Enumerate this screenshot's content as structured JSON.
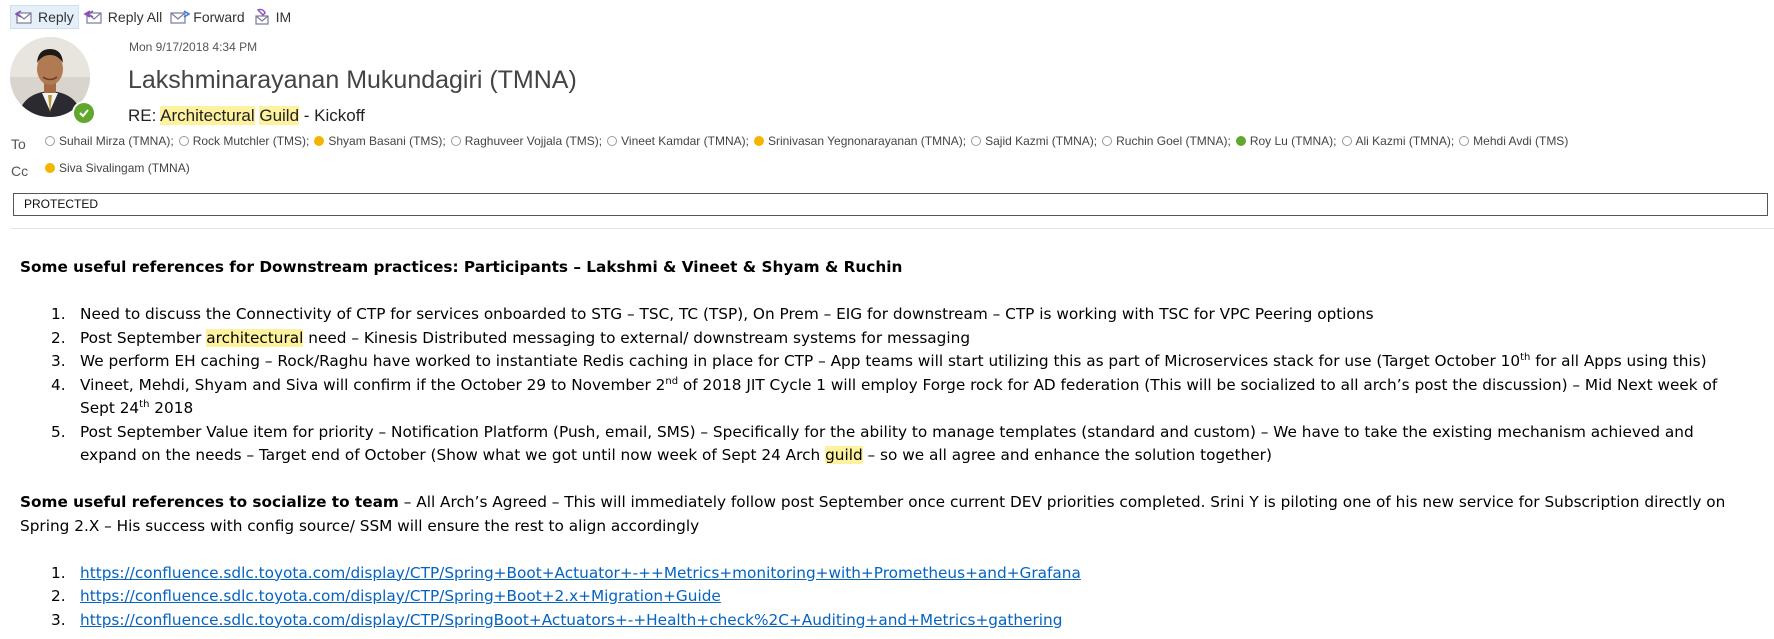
{
  "toolbar": {
    "reply": "Reply",
    "reply_all": "Reply All",
    "forward": "Forward",
    "im": "IM"
  },
  "header": {
    "date": "Mon 9/17/2018 4:34 PM",
    "sender": "Lakshminarayanan Mukundagiri (TMNA)",
    "subject_prefix": "RE: ",
    "subject_hl1": "Architectural",
    "subject_hl2": "Guild",
    "subject_suffix": " - Kickoff",
    "to_label": "To",
    "cc_label": "Cc",
    "to": [
      {
        "name": "Suhail Mirza (TMNA);",
        "status": "offline"
      },
      {
        "name": "Rock Mutchler (TMS);",
        "status": "offline"
      },
      {
        "name": "Shyam Basani (TMS);",
        "status": "away"
      },
      {
        "name": "Raghuveer Vojjala (TMS);",
        "status": "offline"
      },
      {
        "name": "Vineet Kamdar (TMNA);",
        "status": "offline"
      },
      {
        "name": "Srinivasan Yegnonarayanan (TMNA);",
        "status": "away"
      },
      {
        "name": "Sajid Kazmi (TMNA);",
        "status": "offline"
      },
      {
        "name": "Ruchin Goel (TMNA);",
        "status": "offline"
      },
      {
        "name": "Roy Lu (TMNA);",
        "status": "available"
      },
      {
        "name": "Ali Kazmi (TMNA);",
        "status": "offline"
      },
      {
        "name": "Mehdi Avdi (TMS)",
        "status": "offline"
      }
    ],
    "cc": [
      {
        "name": "Siva Sivalingam (TMNA)",
        "status": "away"
      }
    ],
    "classification": "PROTECTED"
  },
  "body": {
    "heading1": "Some useful references for Downstream practices: Participants – Lakshmi & Vineet & Shyam & Ruchin",
    "items1": [
      {
        "num": "1.",
        "text": "Need to discuss the Connectivity of CTP for services onboarded to STG – TSC, TC (TSP), On Prem – EIG for downstream – CTP is working with TSC for VPC Peering options"
      },
      {
        "num": "2.",
        "a": "Post September ",
        "hl": "architectural",
        "b": " need – Kinesis Distributed messaging to external/ downstream systems for messaging"
      },
      {
        "num": "3.",
        "a": "We perform EH caching – Rock/Raghu have worked to instantiate Redis caching in place for CTP – App teams will start utilizing this as part of Microservices stack for use (Target October 10",
        "sup": "th",
        "b": " for all Apps using this)"
      },
      {
        "num": "4.",
        "a": "Vineet, Mehdi, Shyam and Siva will confirm if the October 29 to November 2",
        "sup": "nd",
        "b": " of 2018 JIT Cycle 1 will employ Forge rock for AD federation (This will be socialized to all arch’s post the discussion) – Mid Next week of Sept 24",
        "sup2": "th",
        "c": " 2018"
      },
      {
        "num": "5.",
        "a": "Post September Value item for priority – Notification Platform (Push, email, SMS) – Specifically for the ability to manage templates (standard and custom) – We have to take the existing mechanism achieved and expand on the needs – Target end of October (Show what we got until now week of Sept 24 Arch ",
        "hl": "guild",
        "b": " – so we all agree and enhance the solution together)"
      }
    ],
    "heading2": "Some useful references to socialize to team",
    "para2": " – All Arch’s Agreed – This will immediately follow post September once current DEV priorities completed. Srini Y is piloting one of his new service for Subscription directly on Spring 2.X – His success with config source/ SSM will ensure the rest to align accordingly",
    "links": [
      {
        "num": "1.",
        "url": "https://confluence.sdlc.toyota.com/display/CTP/Spring+Boot+Actuator+-++Metrics+monitoring+with+Prometheus+and+Grafana"
      },
      {
        "num": "2.",
        "url": "https://confluence.sdlc.toyota.com/display/CTP/Spring+Boot+2.x+Migration+Guide"
      },
      {
        "num": "3.",
        "url": "https://confluence.sdlc.toyota.com/display/CTP/SpringBoot+Actuators+-+Health+check%2C+Auditing+and+Metrics+gathering"
      }
    ]
  }
}
